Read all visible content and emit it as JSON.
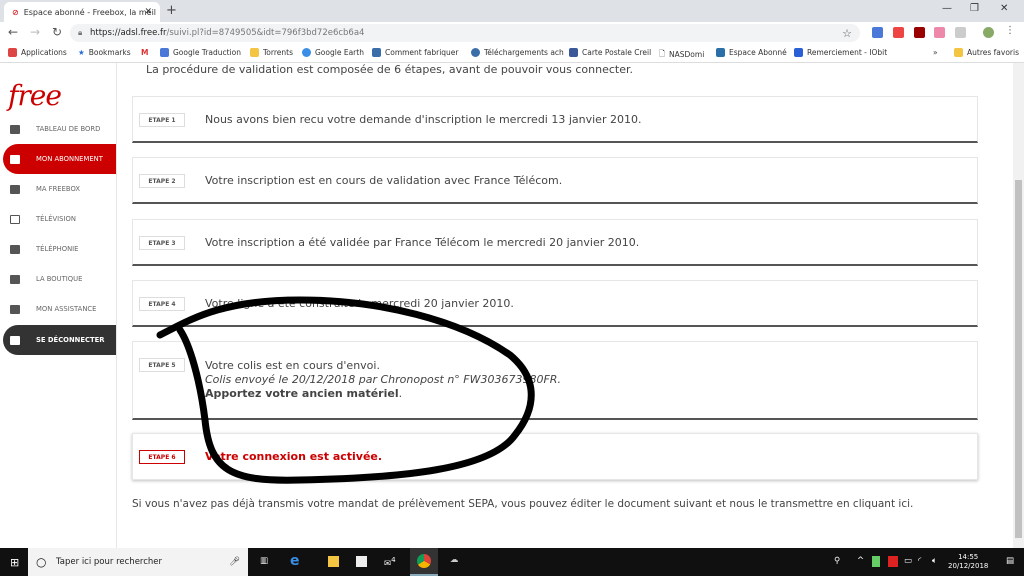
{
  "browser": {
    "tab_title": "Espace abonné - Freebox, la meil",
    "url_host": "https://adsl.free.fr",
    "url_path": "/suivi.pl?id=8749505&idt=796f3bd72e6cb6a4",
    "bookmarks": [
      "Applications",
      "Bookmarks",
      "Google Traduction",
      "Torrents",
      "Google Earth",
      "Comment fabriquer",
      "Téléchargements ach",
      "Carte Postale Creil",
      "NASDomi",
      "Espace Abonné",
      "Remerciement - IObit"
    ],
    "other_bookmarks": "Autres favoris"
  },
  "sidebar": {
    "logo": "free",
    "items": [
      {
        "label": "TABLEAU DE BORD",
        "icon": "dashboard-icon"
      },
      {
        "label": "MON ABONNEMENT",
        "icon": "account-icon",
        "active": true
      },
      {
        "label": "MA FREEBOX",
        "icon": "freebox-icon"
      },
      {
        "label": "TÉLÉVISION",
        "icon": "tv-icon"
      },
      {
        "label": "TÉLÉPHONIE",
        "icon": "phone-icon"
      },
      {
        "label": "LA BOUTIQUE",
        "icon": "cart-icon"
      },
      {
        "label": "MON ASSISTANCE",
        "icon": "chat-icon"
      },
      {
        "label": "SE DÉCONNECTER",
        "icon": "logout-icon"
      }
    ]
  },
  "main": {
    "intro": "La procédure de validation est composée de 6 étapes, avant de pouvoir vous connecter.",
    "steps": [
      {
        "badge": "ETAPE 1",
        "text": "Nous avons bien recu votre demande d'inscription le mercredi 13 janvier 2010."
      },
      {
        "badge": "ETAPE 2",
        "text": "Votre inscription est en cours de validation avec France Télécom."
      },
      {
        "badge": "ETAPE 3",
        "text": "Votre inscription a été validée par France Télécom le mercredi 20 janvier 2010."
      },
      {
        "badge": "ETAPE 4",
        "text": "Votre ligne a été construite le mercredi 20 janvier 2010."
      },
      {
        "badge": "ETAPE 5",
        "text": "Votre colis est en cours d'envoi.",
        "detail": "Colis envoyé le 20/12/2018 par Chronopost n° FW303673980FR.",
        "bold": "Apportez votre ancien matériel",
        "bold_suffix": "."
      },
      {
        "badge": "ETAPE 6",
        "text": "Votre connexion est activée."
      }
    ],
    "footer": "Si vous n'avez pas déjà transmis votre mandat de prélèvement SEPA, vous pouvez éditer le document suivant et nous le transmettre en cliquant ici."
  },
  "taskbar": {
    "search_placeholder": "Taper ici pour rechercher",
    "time": "14:55",
    "date": "20/12/2018",
    "mail_badge": "4"
  },
  "colors": {
    "accent": "#cc0000",
    "dark": "#333333"
  }
}
